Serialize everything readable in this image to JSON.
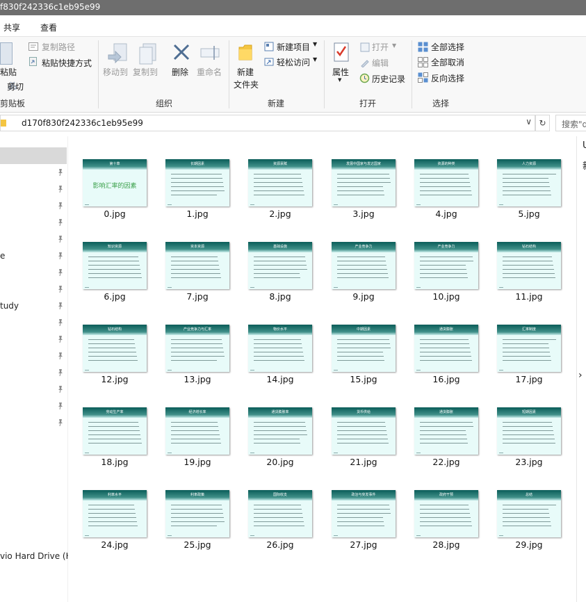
{
  "window": {
    "title": "f830f242336c1eb95e99"
  },
  "menu": {
    "share": "共享",
    "view": "查看"
  },
  "ribbon": {
    "clipboard": {
      "paste": "粘贴",
      "cut": "剪切",
      "copy_path": "复制路径",
      "paste_shortcut": "粘贴快捷方式",
      "label": "剪贴板"
    },
    "organize": {
      "move_to": "移动到",
      "copy_to": "复制到",
      "delete": "删除",
      "rename": "重命名",
      "label": "组织"
    },
    "new": {
      "new_item": "新建项目",
      "easy_access": "轻松访问",
      "new_folder_l1": "新建",
      "new_folder_l2": "文件夹",
      "label": "新建"
    },
    "open": {
      "properties": "属性",
      "open": "打开",
      "edit": "编辑",
      "history": "历史记录",
      "label": "打开"
    },
    "select": {
      "select_all": "全部选择",
      "select_none": "全部取消",
      "invert": "反向选择",
      "label": "选择"
    }
  },
  "address": {
    "path": "d170f830f242336c1eb95e99",
    "refresh": "↻",
    "search_placeholder": "搜索\"d"
  },
  "nav": {
    "items": [
      {
        "label": "e"
      },
      {
        "label": "tudy"
      },
      {
        "label": "vio Hard Drive (H"
      }
    ]
  },
  "right_panel": {
    "t1": "U",
    "t2": "新"
  },
  "files": [
    {
      "name": "0.jpg",
      "title": "第十章",
      "caption": "影响汇率的因素"
    },
    {
      "name": "1.jpg",
      "title": "长期因素"
    },
    {
      "name": "2.jpg",
      "title": "资源禀赋"
    },
    {
      "name": "3.jpg",
      "title": "发展中国家与发达国家"
    },
    {
      "name": "4.jpg",
      "title": "资源的种类"
    },
    {
      "name": "5.jpg",
      "title": "人力资源"
    },
    {
      "name": "6.jpg",
      "title": "知识资源"
    },
    {
      "name": "7.jpg",
      "title": "资本资源"
    },
    {
      "name": "8.jpg",
      "title": "基础设施"
    },
    {
      "name": "9.jpg",
      "title": "产业竞争力"
    },
    {
      "name": "10.jpg",
      "title": "产业竞争力"
    },
    {
      "name": "11.jpg",
      "title": "钻石结构"
    },
    {
      "name": "12.jpg",
      "title": "钻石结构"
    },
    {
      "name": "13.jpg",
      "title": "产业竞争力与汇率"
    },
    {
      "name": "14.jpg",
      "title": "物价水平"
    },
    {
      "name": "15.jpg",
      "title": "中期因素"
    },
    {
      "name": "16.jpg",
      "title": "通货膨胀"
    },
    {
      "name": "17.jpg",
      "title": "汇率制度"
    },
    {
      "name": "18.jpg",
      "title": "劳动生产率"
    },
    {
      "name": "19.jpg",
      "title": "经济增长率"
    },
    {
      "name": "20.jpg",
      "title": "通货膨胀率"
    },
    {
      "name": "21.jpg",
      "title": "货币供给"
    },
    {
      "name": "22.jpg",
      "title": "通货膨胀"
    },
    {
      "name": "23.jpg",
      "title": "短期因素"
    },
    {
      "name": "24.jpg",
      "title": "利率水平"
    },
    {
      "name": "25.jpg",
      "title": "利率政策"
    },
    {
      "name": "26.jpg",
      "title": "国际收支"
    },
    {
      "name": "27.jpg",
      "title": "政治与突发事件"
    },
    {
      "name": "28.jpg",
      "title": "政府干预"
    },
    {
      "name": "29.jpg",
      "title": "总结"
    }
  ],
  "colors": {
    "thumb_band": "#0a5d59",
    "thumb_bg": "#e8fbf9",
    "caption_green": "#3aa04a"
  }
}
